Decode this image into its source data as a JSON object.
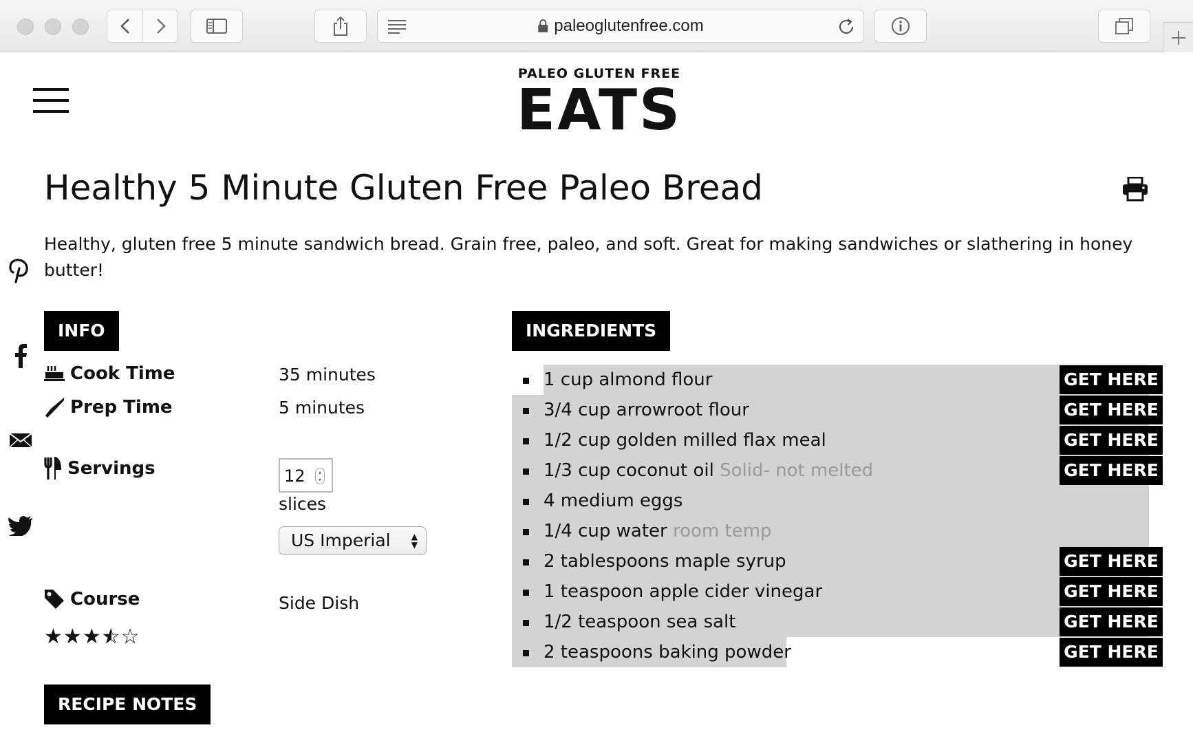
{
  "browser": {
    "url": "paleoglutenfree.com"
  },
  "site": {
    "brand_small": "PALEO GLUTEN FREE",
    "brand_big": "EATS"
  },
  "recipe": {
    "title": "Healthy 5 Minute Gluten Free Paleo Bread",
    "summary": "Healthy, gluten free 5 minute sandwich bread. Grain free, paleo, and soft. Great for making sandwiches or slathering in honey butter!",
    "info_label": "INFO",
    "cook_time_label": "Cook Time",
    "cook_time_value": "35 minutes",
    "prep_time_label": "Prep Time",
    "prep_time_value": "5 minutes",
    "servings_label": "Servings",
    "servings_value": "12",
    "servings_unit": "slices",
    "unit_system": "US Imperial",
    "course_label": "Course",
    "course_value": "Side Dish",
    "rating": 3.5,
    "rating_max": 5,
    "notes_label": "RECIPE NOTES",
    "ingredients_label": "INGREDIENTS",
    "get_here_label": "GET HERE",
    "ingredients": [
      {
        "text": "1 cup almond flour",
        "note": "",
        "has_link": true
      },
      {
        "text": "3/4 cup arrowroot flour",
        "note": "",
        "has_link": true
      },
      {
        "text": "1/2 cup golden milled flax meal",
        "note": "",
        "has_link": true
      },
      {
        "text": "1/3 cup coconut oil",
        "note": "Solid- not melted",
        "has_link": true
      },
      {
        "text": "4 medium eggs",
        "note": "",
        "has_link": false
      },
      {
        "text": "1/4 cup water",
        "note": "room temp",
        "has_link": false
      },
      {
        "text": "2 tablespoons maple syrup",
        "note": "",
        "has_link": true
      },
      {
        "text": "1 teaspoon apple cider vinegar",
        "note": "",
        "has_link": true
      },
      {
        "text": "1/2 teaspoon sea salt",
        "note": "",
        "has_link": true
      },
      {
        "text": "2 teaspoons baking powder",
        "note": "",
        "has_link": true
      }
    ]
  },
  "social": {
    "icons": [
      "pinterest-icon",
      "facebook-icon",
      "email-icon",
      "twitter-icon"
    ]
  },
  "colors": {
    "label_bg": "#000000",
    "highlight": "#d3d3d3",
    "note_text": "#9a9a9a"
  }
}
